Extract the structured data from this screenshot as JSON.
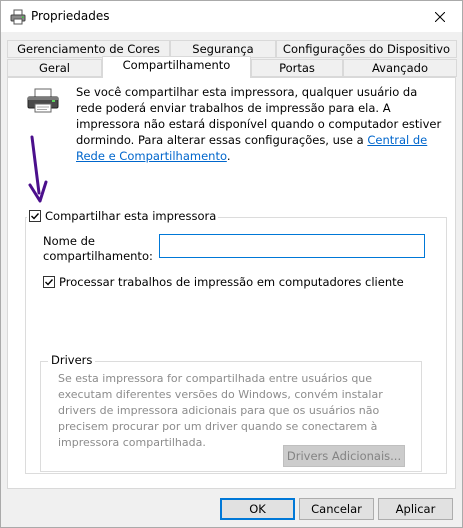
{
  "window": {
    "title": "Propriedades"
  },
  "tabs": {
    "row1": [
      "Gerenciamento de Cores",
      "Segurança",
      "Configurações do Dispositivo"
    ],
    "row2": [
      "Geral",
      "Compartilhamento",
      "Portas",
      "Avançado"
    ],
    "active": "Compartilhamento"
  },
  "sharing": {
    "description": "Se você compartilhar esta impressora, qualquer usuário da rede poderá enviar trabalhos de impressão para ela. A impressora não estará disponível quando o computador estiver dormindo. Para alterar essas configurações, use a ",
    "link_text": "Central de Rede e Compartilhamento",
    "description_end": ".",
    "share_checkbox_label": "Compartilhar esta impressora",
    "share_checked": true,
    "share_name_label": "Nome de compartilhamento:",
    "share_name_value": "",
    "render_checkbox_label": "Processar trabalhos de impressão em computadores cliente",
    "render_checked": true
  },
  "drivers": {
    "group_label": "Drivers",
    "text": "Se esta impressora for compartilhada entre usuários que executam diferentes versões do Windows, convém instalar drivers de impressora adicionais para que os usuários não precisem procurar por um driver quando se conectarem à impressora compartilhada.",
    "additional_button": "Drivers Adicionais..."
  },
  "buttons": {
    "ok": "OK",
    "cancel": "Cancelar",
    "apply": "Aplicar"
  },
  "colors": {
    "link": "#0066cc",
    "accent": "#0078d7",
    "annotation_arrow": "#4b0f8c"
  },
  "icons": {
    "title": "printer-icon",
    "close": "close-icon",
    "panel": "printer-icon",
    "annotation": "arrow-down-icon"
  }
}
